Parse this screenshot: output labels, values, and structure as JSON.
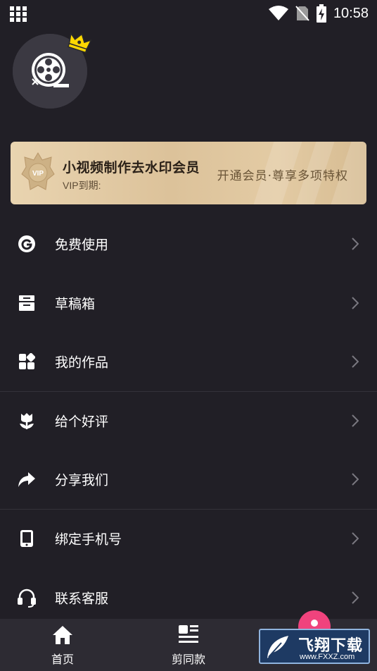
{
  "status_bar": {
    "time": "10:58"
  },
  "vip": {
    "title": "小视频制作去水印会员",
    "expire_label": "VIP到期:",
    "cta": "开通会员·尊享多项特权",
    "badge_text": "VIP"
  },
  "menu": [
    {
      "label": "免费使用",
      "icon": "google-g-icon"
    },
    {
      "label": "草稿箱",
      "icon": "inbox-icon"
    },
    {
      "label": "我的作品",
      "icon": "apps-icon"
    },
    {
      "label": "给个好评",
      "icon": "flower-icon"
    },
    {
      "label": "分享我们",
      "icon": "share-icon"
    },
    {
      "label": "绑定手机号",
      "icon": "phone-icon"
    },
    {
      "label": "联系客服",
      "icon": "headset-icon"
    }
  ],
  "bottom_nav": [
    {
      "label": "首页",
      "icon": "home-icon"
    },
    {
      "label": "剪同款",
      "icon": "template-icon"
    }
  ],
  "watermark": {
    "text": "飞翔下载",
    "sub": "www.FXXZ.com"
  },
  "colors": {
    "background": "#211f26",
    "accent": "#f0437d",
    "vip_gold": "#e3cba4"
  }
}
